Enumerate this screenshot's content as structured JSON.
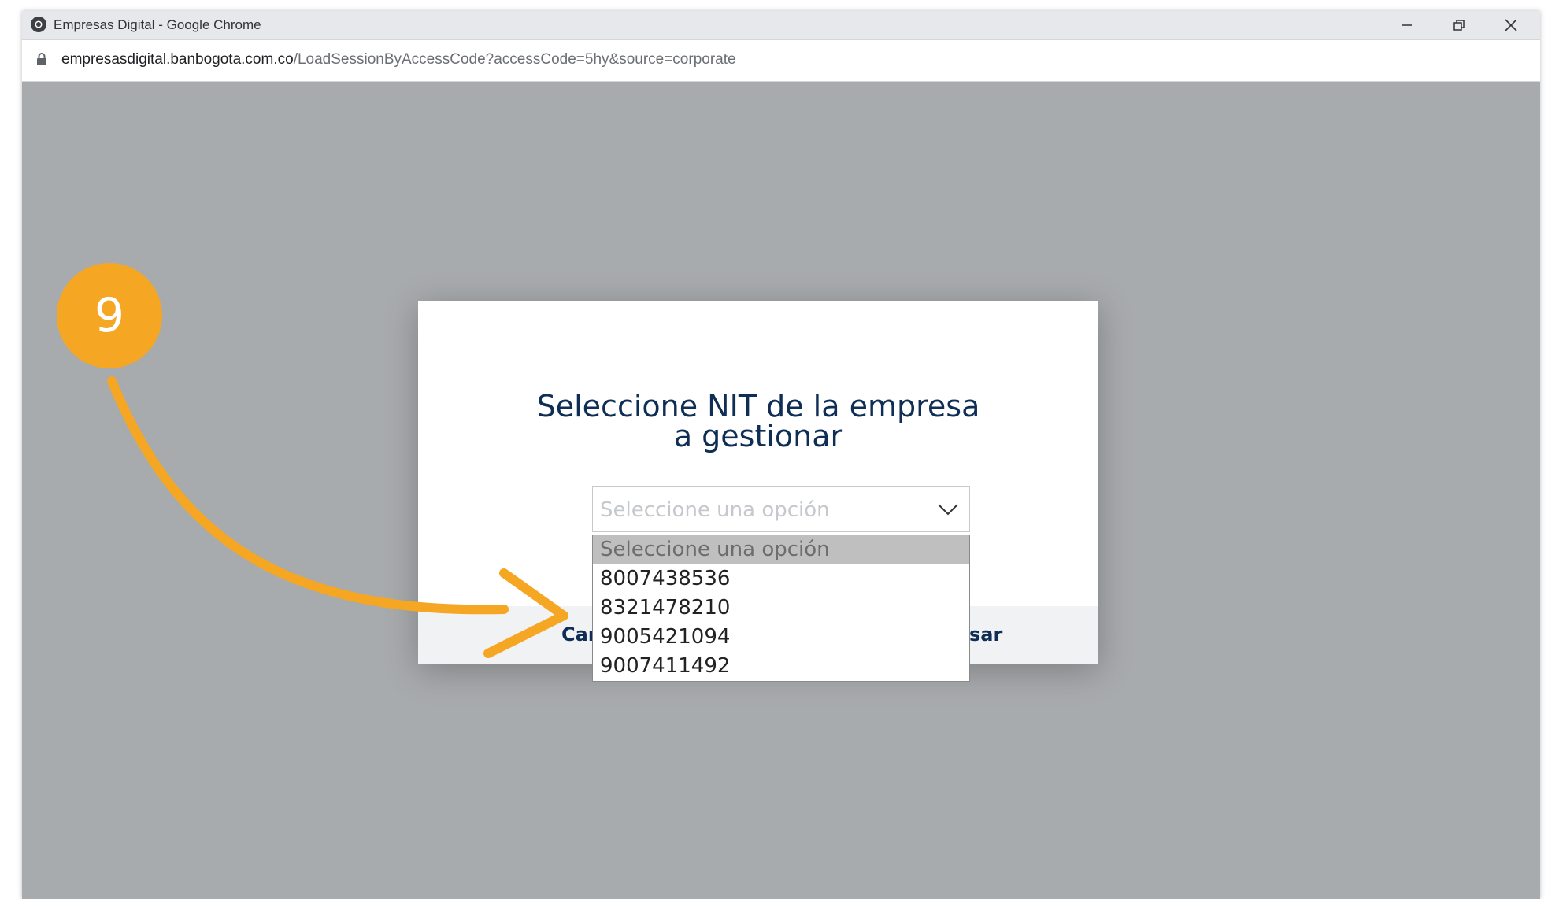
{
  "browser": {
    "window_title": "Empresas Digital - Google Chrome",
    "url_host": "empresasdigital.banbogota.com.co",
    "url_path": "/LoadSessionByAccessCode?accessCode=5hy&source=corporate",
    "icons": {
      "favicon": "chrome-logo-icon",
      "lock": "lock-icon",
      "minimize": "minimize-icon",
      "restore": "restore-icon",
      "close": "close-icon"
    }
  },
  "modal": {
    "title_line1": "Seleccione NIT de la empresa",
    "title_line2": "a gestionar",
    "select": {
      "placeholder": "Seleccione una opción",
      "options": [
        "Seleccione una opción",
        "8007438536",
        "8321478210",
        "9005421094",
        "9007411492"
      ]
    },
    "footer": {
      "cancel_visible": "Can",
      "ingresar_visible": "sar"
    }
  },
  "annotation": {
    "step_number": "9",
    "color": "#f5a623"
  },
  "colors": {
    "overlay": "#a8abad",
    "title": "#0f2e55",
    "accent": "#f5a623"
  }
}
